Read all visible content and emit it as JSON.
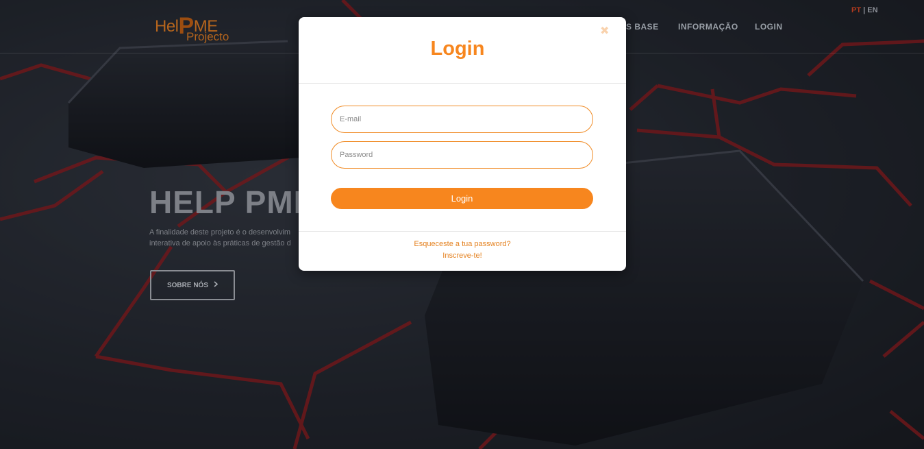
{
  "header": {
    "logo_line1": "Hel",
    "logo_p": "P",
    "logo_me": "ME",
    "logo_line2": "Projecto",
    "nav": [
      "S BASE",
      "INFORMAÇÃO",
      "LOGIN"
    ],
    "lang": {
      "pt": "PT",
      "sep": "|",
      "en": "EN"
    }
  },
  "hero": {
    "title": "HELP PME",
    "text_line1": "A finalidade deste projeto é o desenvolvim",
    "text_line2": "interativa de apoio às práticas de gestão d",
    "button_label": "SOBRE NÓS",
    "button_icon": "chevron-right-icon"
  },
  "modal": {
    "title": "Login",
    "close_icon": "close-icon",
    "email_placeholder": "E-mail",
    "password_placeholder": "Password",
    "login_button": "Login",
    "forgot_link": "Esqueceste a tua password?",
    "register_link": "Inscreve-te!"
  },
  "colors": {
    "accent": "#f7861e",
    "lines": "#b01515"
  }
}
